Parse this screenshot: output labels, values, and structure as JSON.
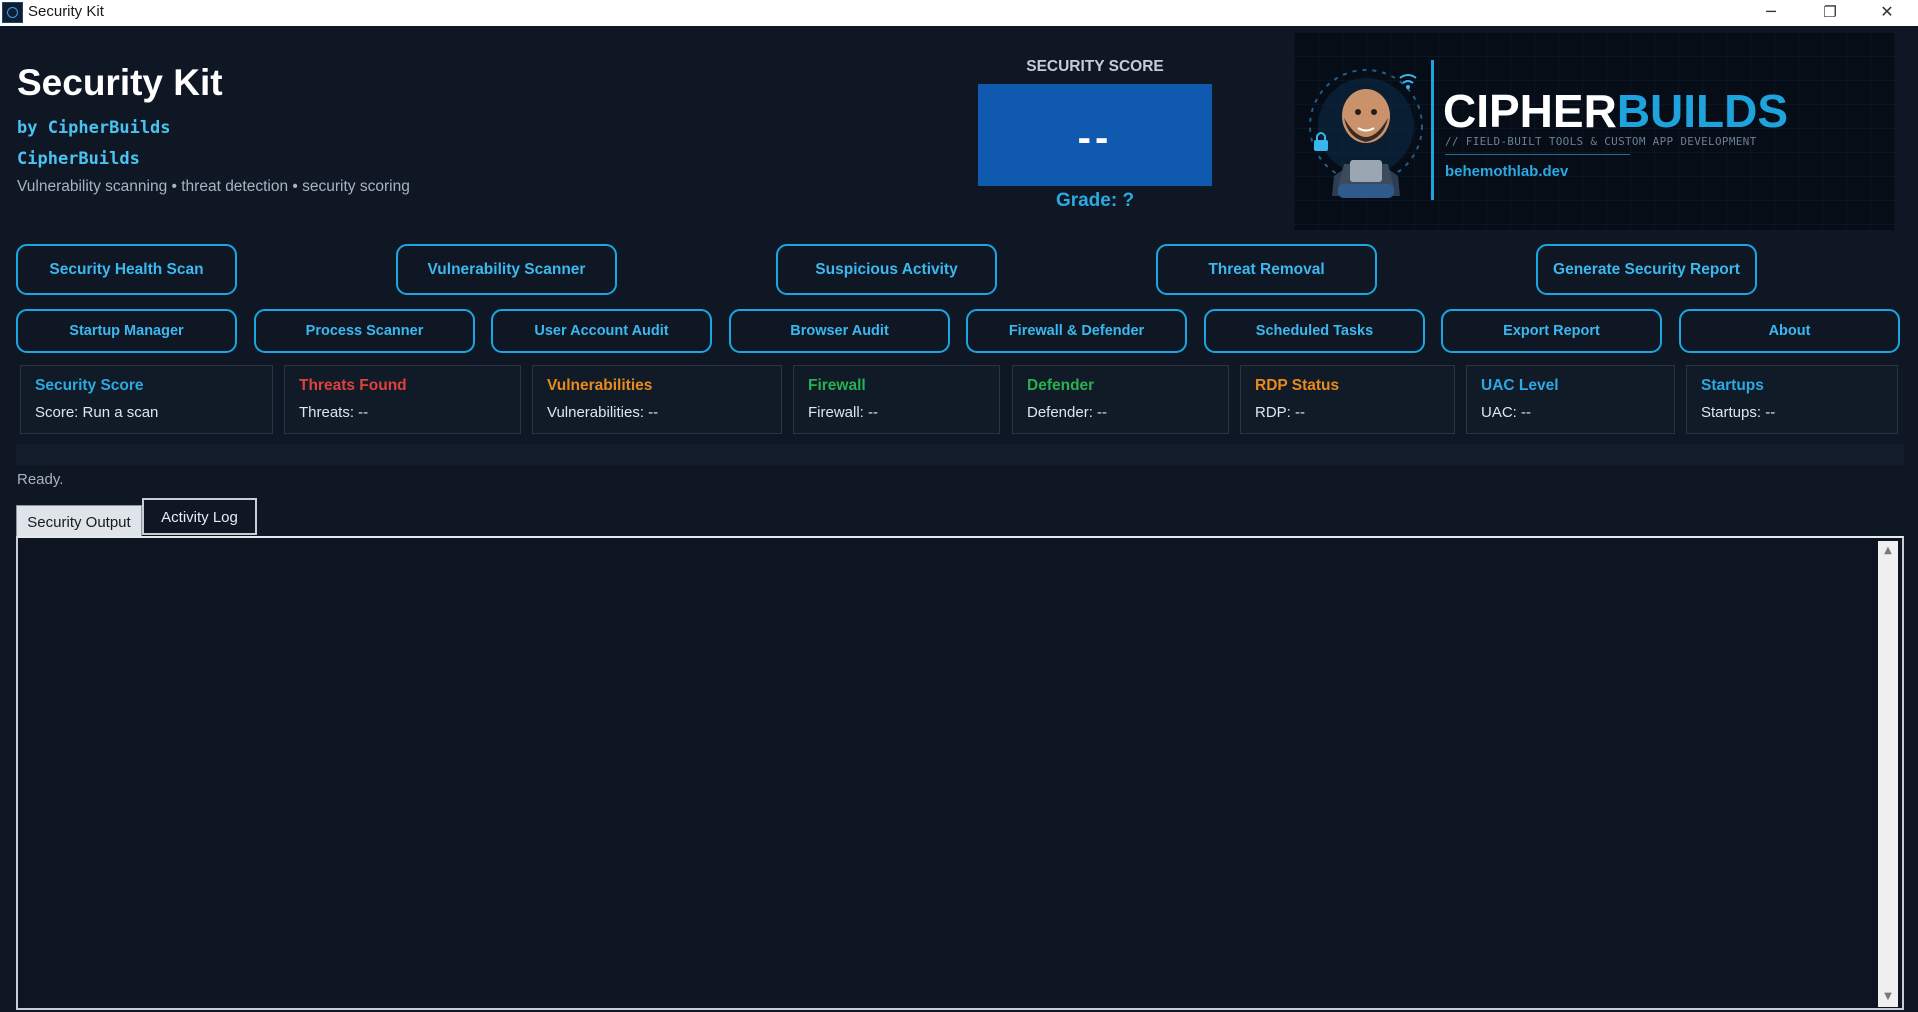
{
  "window": {
    "title": "Security Kit",
    "minimize_glyph": "─",
    "maximize_glyph": "❐",
    "close_glyph": "✕"
  },
  "header": {
    "title": "Security Kit",
    "by_line": "by CipherBuilds",
    "brand": "CipherBuilds",
    "tagline": "Vulnerability scanning  •  threat detection  •  security scoring"
  },
  "score": {
    "label": "SECURITY SCORE",
    "value": "--",
    "grade": "Grade: ?",
    "box_color": "#0f5aaf"
  },
  "logo": {
    "word_a": "CIPHER",
    "word_b": "BUILDS",
    "subtitle": "// FIELD-BUILT TOOLS & CUSTOM APP DEVELOPMENT",
    "url": "behemothlab.dev",
    "accent_color": "#1fa3dd"
  },
  "buttons_row1": [
    {
      "label": "Security Health Scan"
    },
    {
      "label": "Vulnerability Scanner"
    },
    {
      "label": "Suspicious Activity"
    },
    {
      "label": "Threat Removal"
    },
    {
      "label": "Generate Security Report"
    }
  ],
  "buttons_row2": [
    {
      "label": "Startup Manager"
    },
    {
      "label": "Process Scanner"
    },
    {
      "label": "User Account Audit"
    },
    {
      "label": "Browser Audit"
    },
    {
      "label": "Firewall & Defender"
    },
    {
      "label": "Scheduled Tasks"
    },
    {
      "label": "Export Report"
    },
    {
      "label": "About"
    }
  ],
  "cards": [
    {
      "title": "Security Score",
      "value": "Score: Run a scan",
      "color": "#2aa9e2"
    },
    {
      "title": "Threats Found",
      "value": "Threats: --",
      "color": "#e0413d"
    },
    {
      "title": "Vulnerabilities",
      "value": "Vulnerabilities: --",
      "color": "#e98a1c"
    },
    {
      "title": "Firewall",
      "value": "Firewall: --",
      "color": "#27b24f"
    },
    {
      "title": "Defender",
      "value": "Defender: --",
      "color": "#27b24f"
    },
    {
      "title": "RDP Status",
      "value": "RDP: --",
      "color": "#e98a1c"
    },
    {
      "title": "UAC Level",
      "value": "UAC: --",
      "color": "#2aa9e2"
    },
    {
      "title": "Startups",
      "value": "Startups: --",
      "color": "#2aa9e2"
    }
  ],
  "status": "Ready.",
  "tabs": [
    {
      "label": "Security Output",
      "active": true
    },
    {
      "label": "Activity Log",
      "active": false
    }
  ],
  "output": {
    "text": "",
    "scroll_up_glyph": "▲",
    "scroll_down_glyph": "▼"
  },
  "colors": {
    "background": "#0f1724",
    "accent": "#1aa6e0",
    "button_text": "#3cb8ee"
  }
}
